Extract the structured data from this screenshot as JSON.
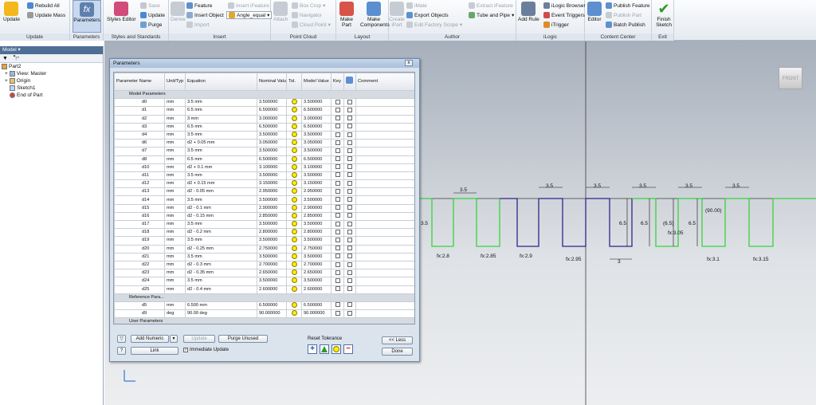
{
  "ribbon": {
    "update": "Update",
    "rebuild_all": "Rebuild All",
    "update_mass": "Update Mass",
    "group_update": "Update",
    "parameters": "Parameters",
    "group_parameters": "Parameters",
    "styles_editor": "Styles Editor",
    "save": "Save",
    "update2": "Update",
    "purge": "Purge",
    "group_styles": "Styles and Standards",
    "derive": "Derive",
    "feature": "Feature",
    "insert_object": "Insert Object",
    "import": "Import",
    "insert_ifeature": "Insert iFeature",
    "angle_equal": "Angle_equal",
    "group_insert": "Insert",
    "attach": "Attach",
    "box_crop": "Box Crop",
    "navigator": "Navigator",
    "cloud_point": "Cloud Point",
    "group_point_cloud": "Point Cloud",
    "make_part": "Make Part",
    "make_components": "Make Components",
    "group_layout": "Layout",
    "create_ipart": "Create iPart",
    "imate": "iMate",
    "export_objects": "Export Objects",
    "edit_factory_scope": "Edit Factory Scope",
    "extract_ifeature": "Extract iFeature",
    "tube_and_pipe": "Tube and Pipe",
    "group_author": "Author",
    "add_rule": "Add Rule",
    "ilogic_browser": "iLogic Browser",
    "event_triggers": "Event Triggers",
    "itrigger": "iTrigger",
    "group_ilogic": "iLogic",
    "editor": "Editor",
    "publish_feature": "Publish Feature",
    "publish_part": "Publish Part",
    "batch_publish": "Batch Publish",
    "group_content": "Content Center",
    "finish_sketch": "Finish Sketch",
    "group_exit": "Exit"
  },
  "browser": {
    "title": "Model ▾",
    "items": [
      "Part2",
      "View: Master",
      "Origin",
      "Sketch1",
      "End of Part"
    ]
  },
  "viewcube": "FRONT",
  "dialog": {
    "title": "Parameters",
    "close": "x",
    "headers": [
      "Parameter Name",
      "Unit/Typ",
      "Equation",
      "Nominal Value",
      "Tol.",
      "Model Value",
      "Key",
      "",
      "Comment"
    ],
    "groups": {
      "model": "Model Parameters",
      "reference": "Reference Para...",
      "user": "User Parameters"
    },
    "rows": [
      [
        "d0",
        "mm",
        "3.5 mm",
        "3.500000",
        "3.500000"
      ],
      [
        "d1",
        "mm",
        "6.5 mm",
        "6.500000",
        "6.500000"
      ],
      [
        "d2",
        "mm",
        "3 mm",
        "3.000000",
        "3.000000"
      ],
      [
        "d3",
        "mm",
        "6.5 mm",
        "6.500000",
        "6.500000"
      ],
      [
        "d4",
        "mm",
        "3.5 mm",
        "3.500000",
        "3.500000"
      ],
      [
        "d6",
        "mm",
        "d2 + 0.05 mm",
        "3.050000",
        "3.050000"
      ],
      [
        "d7",
        "mm",
        "3.5 mm",
        "3.500000",
        "3.500000"
      ],
      [
        "d8",
        "mm",
        "6.5 mm",
        "6.500000",
        "6.500000"
      ],
      [
        "d10",
        "mm",
        "d2 + 0.1 mm",
        "3.100000",
        "3.100000"
      ],
      [
        "d11",
        "mm",
        "3.5 mm",
        "3.500000",
        "3.500000"
      ],
      [
        "d12",
        "mm",
        "d2 + 0.15 mm",
        "3.150000",
        "3.150000"
      ],
      [
        "d13",
        "mm",
        "d2 - 0.05 mm",
        "2.950000",
        "2.950000"
      ],
      [
        "d14",
        "mm",
        "3.5 mm",
        "3.500000",
        "3.500000"
      ],
      [
        "d15",
        "mm",
        "d2 - 0.1 mm",
        "2.900000",
        "2.900000"
      ],
      [
        "d16",
        "mm",
        "d2 - 0.15 mm",
        "2.850000",
        "2.850000"
      ],
      [
        "d17",
        "mm",
        "3.5 mm",
        "3.500000",
        "3.500000"
      ],
      [
        "d18",
        "mm",
        "d2 - 0.2 mm",
        "2.800000",
        "2.800000"
      ],
      [
        "d19",
        "mm",
        "3.5 mm",
        "3.500000",
        "3.500000"
      ],
      [
        "d20",
        "mm",
        "d2 - 0.25 mm",
        "2.750000",
        "2.750000"
      ],
      [
        "d21",
        "mm",
        "3.5 mm",
        "3.500000",
        "3.500000"
      ],
      [
        "d22",
        "mm",
        "d2 - 0.3 mm",
        "2.700000",
        "2.700000"
      ],
      [
        "d23",
        "mm",
        "d2 - 0.35 mm",
        "2.650000",
        "2.650000"
      ],
      [
        "d24",
        "mm",
        "3.5 mm",
        "3.500000",
        "3.500000"
      ],
      [
        "d25",
        "mm",
        "d2 - 0.4 mm",
        "2.600000",
        "2.600000"
      ]
    ],
    "ref_rows": [
      [
        "d5",
        "mm",
        "6.500 mm",
        "6.500000",
        "6.500000"
      ],
      [
        "d9",
        "deg",
        "90.00 deg",
        "90.000000",
        "90.000000"
      ]
    ],
    "add_numeric": "Add Numeric",
    "update": "Update",
    "purge_unused": "Purge Unused",
    "link": "Link",
    "immediate_update": "Immediate Update",
    "reset_tolerance": "Reset Tolerance",
    "less": "<< Less",
    "done": "Done"
  },
  "sketch": {
    "dims_top": [
      "3.5",
      "3.5",
      "3.5",
      "3.5",
      "3.5",
      "3.5",
      "3.5"
    ],
    "dims_vert": [
      "6.5",
      "6.5",
      "(6.5)",
      "6.5"
    ],
    "fx": [
      "fx:2.8",
      "fx:2.85",
      "fx:2.9",
      "fx:2.95",
      "fx:3.1",
      "fx:3.15"
    ],
    "fx_mid": "fx:3.05",
    "three": "3",
    "angle": "(90.00)",
    "left": "3.5"
  },
  "colors": {
    "accent": "#4e6e95",
    "green": "#2fd32f",
    "indigo": "#3a1f8c"
  }
}
